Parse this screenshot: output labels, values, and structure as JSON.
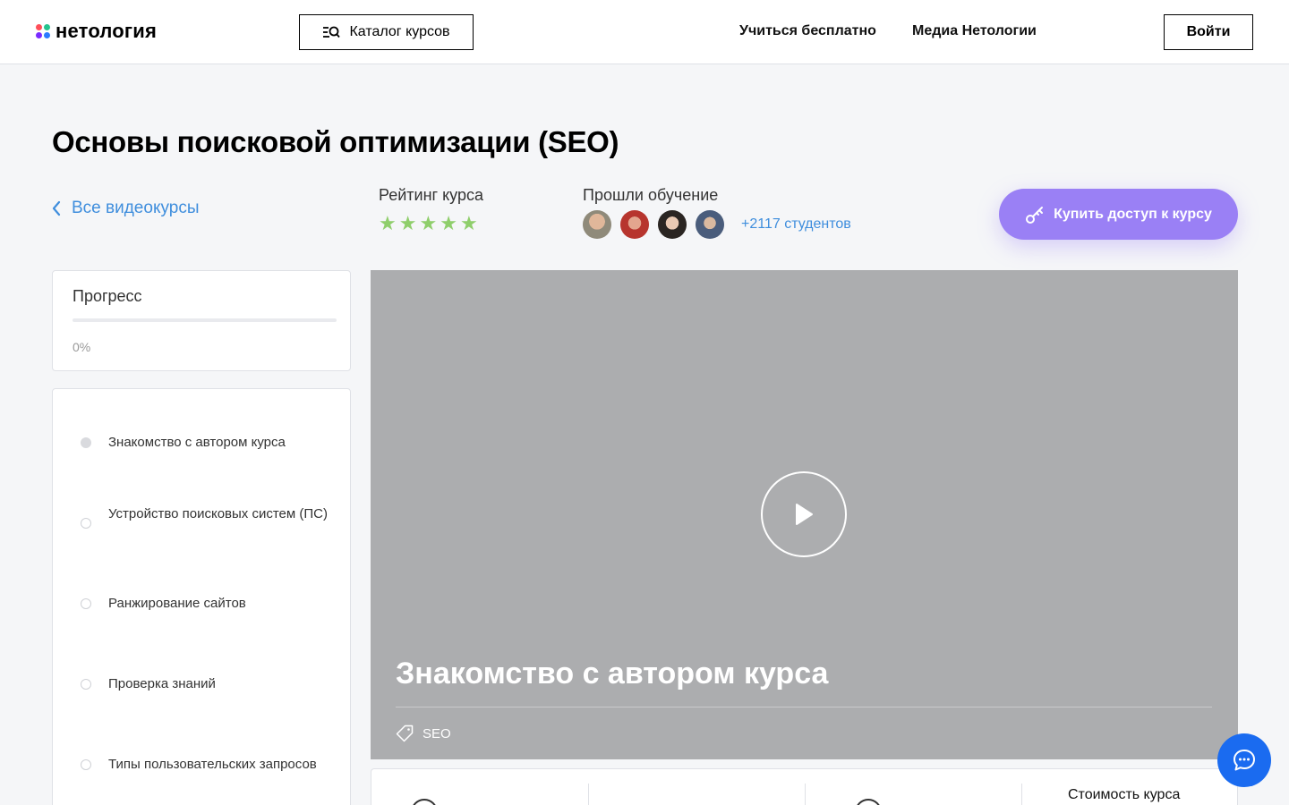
{
  "header": {
    "logo_text": "нетология",
    "catalog_label": "Каталог курсов",
    "nav": [
      {
        "label": "Учиться бесплатно"
      },
      {
        "label": "Медиа Нетологии"
      }
    ],
    "login_label": "Войти"
  },
  "course": {
    "title": "Основы поисковой оптимизации (SEO)",
    "back_label": "Все видеокурсы",
    "rating_label": "Рейтинг курса",
    "rating_stars": 5,
    "passed_label": "Прошли обучение",
    "students_label": "+2117 студентов",
    "buy_label": "Купить доступ к курсу"
  },
  "progress": {
    "title": "Прогресс",
    "percent_label": "0%",
    "value": 0
  },
  "lessons": [
    {
      "label": "Знакомство с автором курса",
      "active": true
    },
    {
      "label": "Устройство поисковых систем (ПС)",
      "active": false
    },
    {
      "label": "Ранжирование сайтов",
      "active": false
    },
    {
      "label": "Проверка знаний",
      "active": false
    },
    {
      "label": "Типы пользовательских запросов",
      "active": false
    }
  ],
  "video": {
    "title": "Знакомство с автором курса",
    "tag": "SEO"
  },
  "info": {
    "cost_label": "Стоимость курса"
  },
  "colors": {
    "accent": "#9a80f5",
    "link": "#3f8edd",
    "star": "#8fce6b",
    "chat": "#1a6bf0"
  }
}
